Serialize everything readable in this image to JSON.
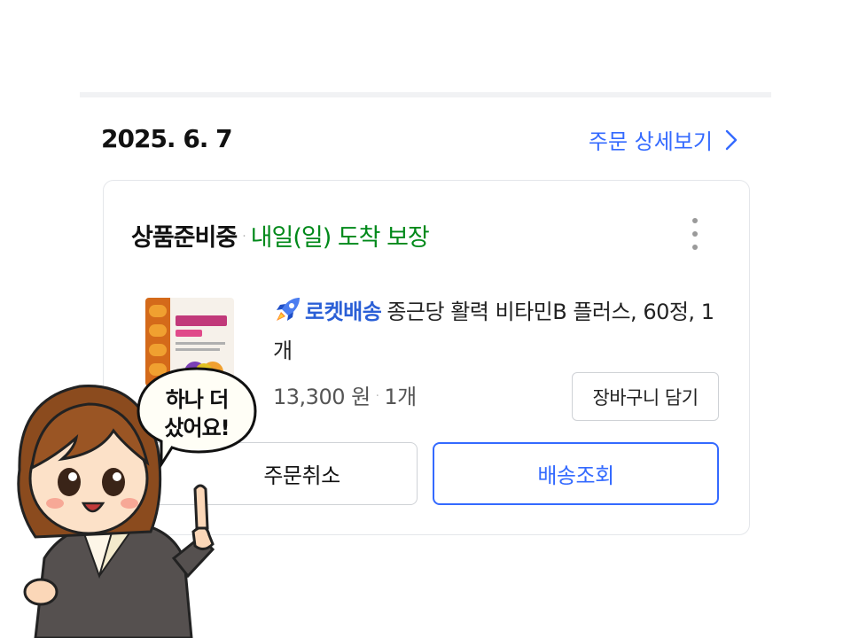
{
  "order": {
    "date": "2025. 6. 7",
    "detail_link_label": "주문 상세보기"
  },
  "card": {
    "status_main": "상품준비중",
    "status_separator": "·",
    "arrival_text": "내일(일) 도착 보장",
    "product": {
      "rocket_label": "로켓배송",
      "name": "종근당 활력 비타민B 플러스, 60정, 1개",
      "price": "13,300 원",
      "separator": "·",
      "quantity": "1개"
    },
    "cart_button_label": "장바구니 담기",
    "cancel_button_label": "주문취소",
    "tracking_button_label": "배송조회"
  },
  "mascot": {
    "speech_line1": "하나 더",
    "speech_line2": "샀어요!"
  },
  "colors": {
    "accent_blue": "#346aff",
    "arrival_green": "#00891a",
    "rocket_blue": "#2a5fd6",
    "border_gray": "#cfd2d6"
  },
  "icons": {
    "detail": "chevron-right-icon",
    "menu": "kebab-menu-icon",
    "rocket": "rocket-icon"
  }
}
